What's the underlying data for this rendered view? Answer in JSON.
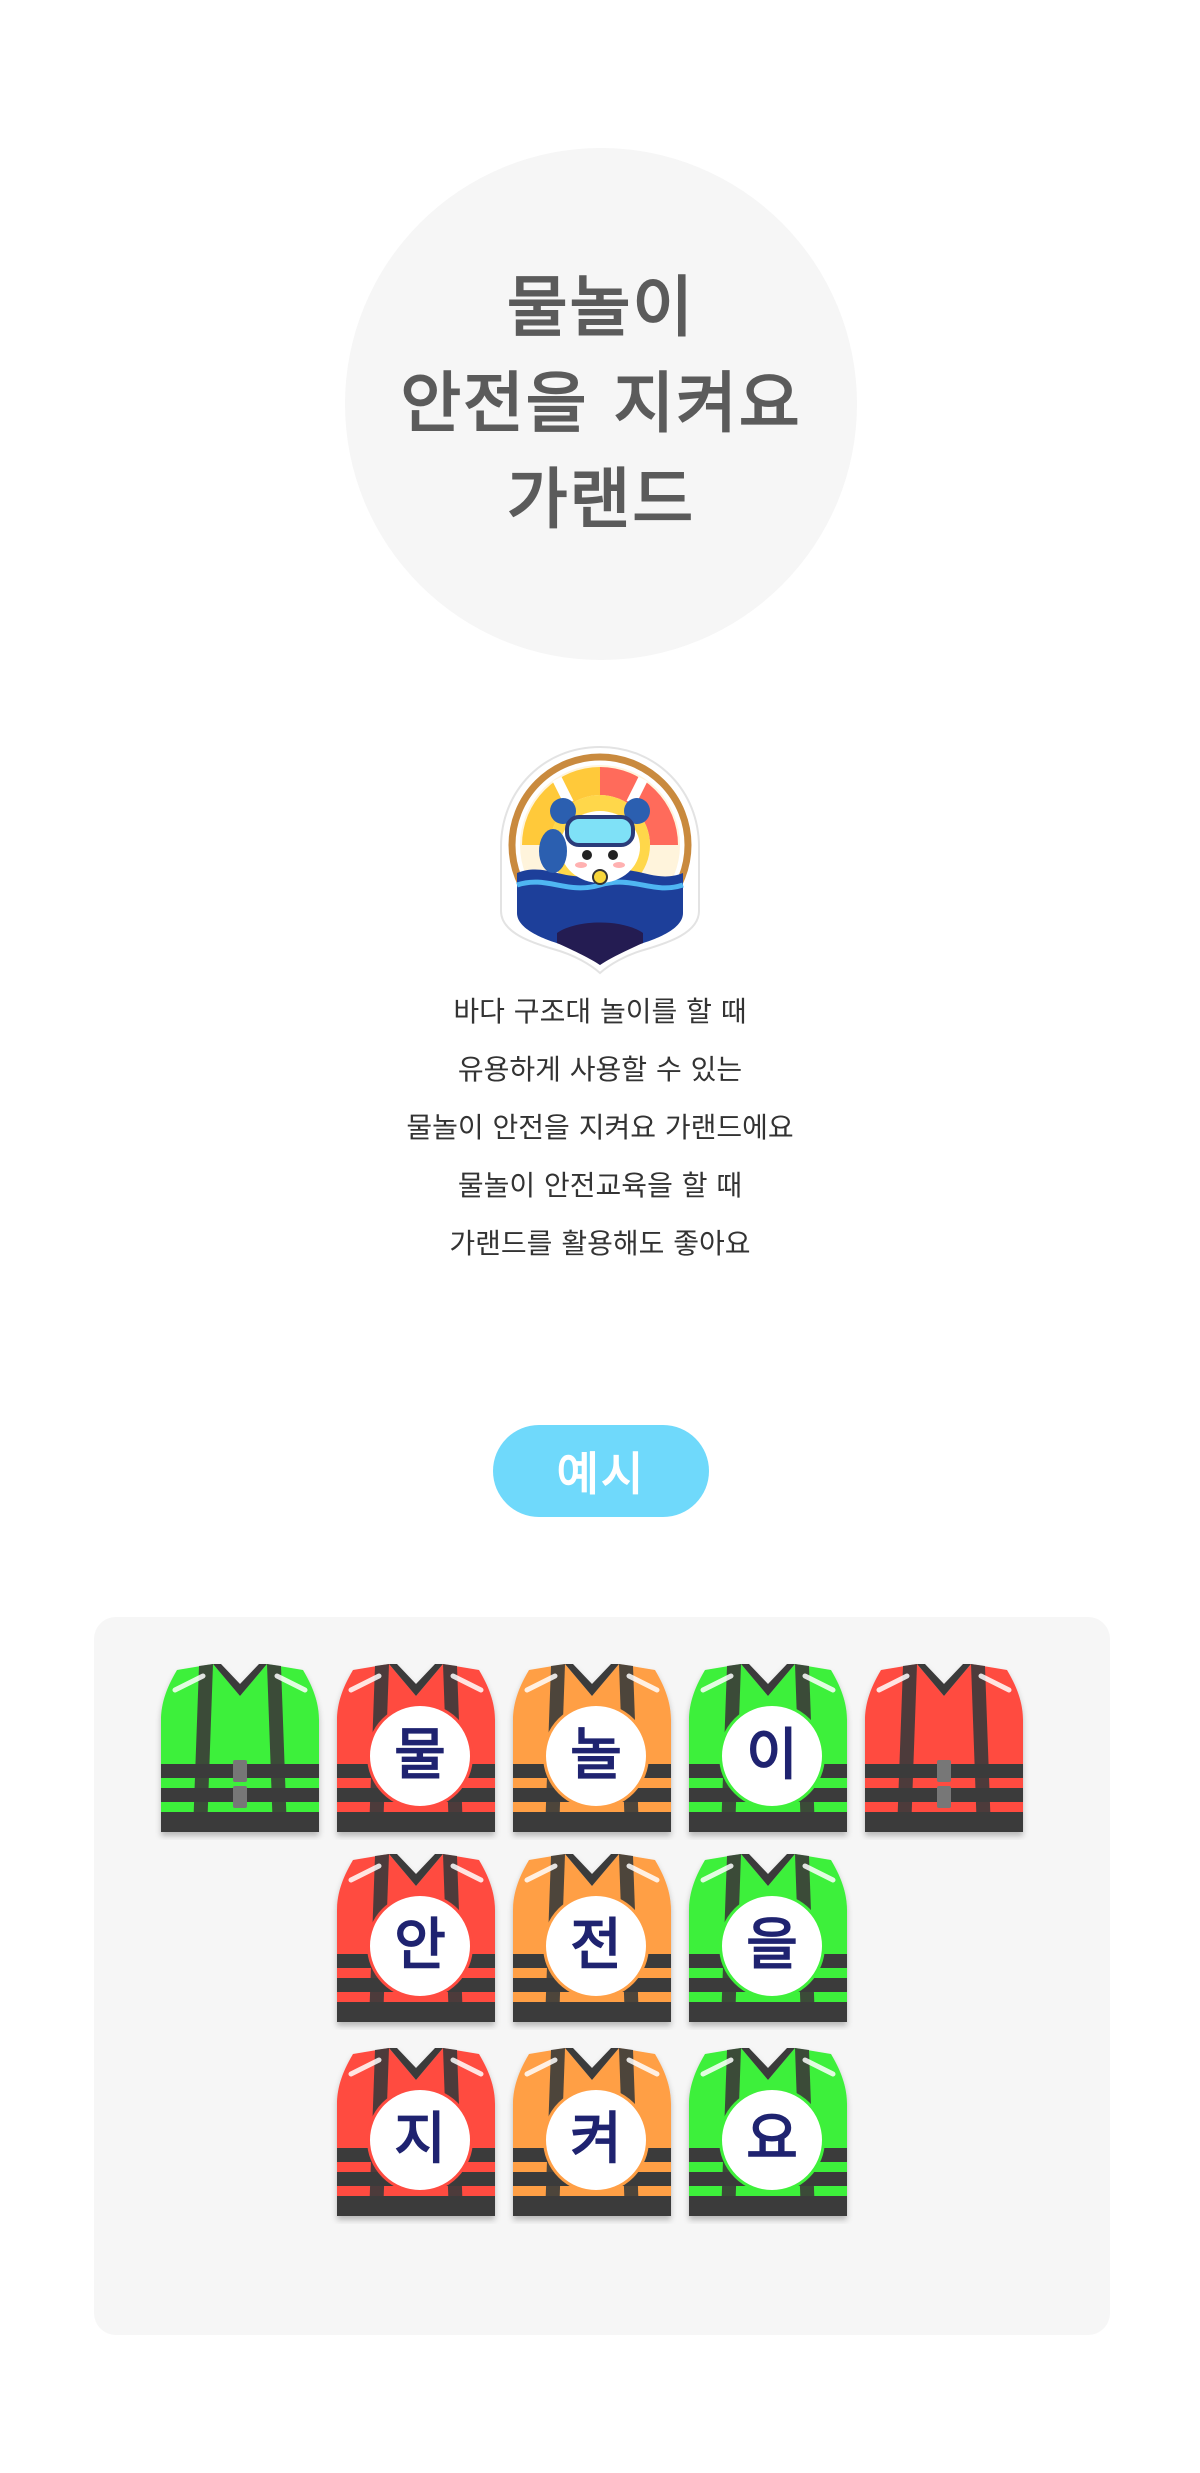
{
  "title": {
    "lines": [
      "물놀이",
      "안전을 지켜요",
      "가랜드"
    ]
  },
  "description": {
    "lines": [
      "바다 구조대 놀이를 할 때",
      "유용하게 사용할 수 있는",
      "물놀이 안전을 지켜요 가랜드에요",
      "물놀이 안전교육을 할 때",
      "가랜드를 활용해도 좋아요"
    ]
  },
  "example": {
    "label": "예시",
    "color": "#6fd9fb"
  },
  "mascot": {
    "icon": "diver-panda-mascot-icon"
  },
  "colors": {
    "green": "#3ef03a",
    "red": "#ff4b40",
    "orange": "#ff9f45",
    "vest_dark": "#3a3a3a"
  },
  "garland": {
    "rows": [
      [
        {
          "letter": "",
          "color": "green"
        },
        {
          "letter": "물",
          "color": "red"
        },
        {
          "letter": "놀",
          "color": "orange"
        },
        {
          "letter": "이",
          "color": "green"
        },
        {
          "letter": "",
          "color": "red"
        }
      ],
      [
        {
          "letter": "안",
          "color": "red"
        },
        {
          "letter": "전",
          "color": "orange"
        },
        {
          "letter": "을",
          "color": "green"
        }
      ],
      [
        {
          "letter": "지",
          "color": "red"
        },
        {
          "letter": "켜",
          "color": "orange"
        },
        {
          "letter": "요",
          "color": "green"
        }
      ]
    ]
  }
}
